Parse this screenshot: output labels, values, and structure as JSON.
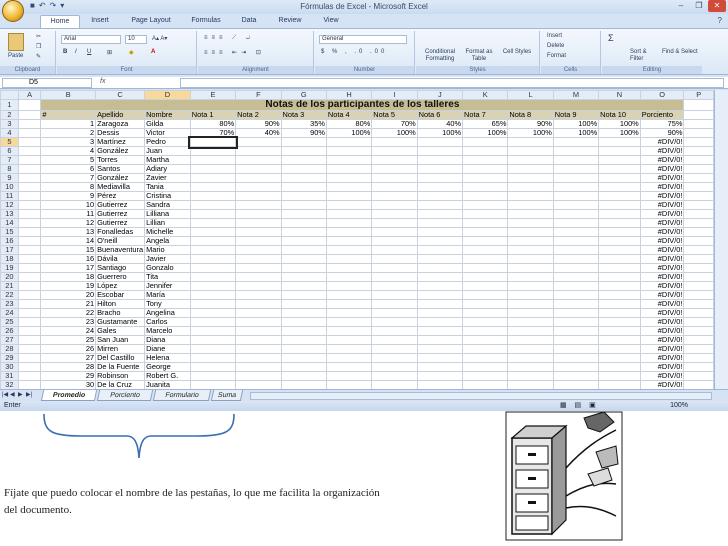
{
  "window": {
    "title": "Fórmulas de Excel - Microsoft Excel",
    "controls": [
      "–",
      "❐",
      "✕"
    ]
  },
  "ribbon": {
    "tabs": [
      "Home",
      "Insert",
      "Page Layout",
      "Formulas",
      "Data",
      "Review",
      "View"
    ],
    "active_tab": "Home",
    "paste": "Paste",
    "font_name": "Arial",
    "font_size": "10",
    "number_format": "General",
    "groups": [
      "Clipboard",
      "Font",
      "Alignment",
      "Number",
      "Styles",
      "Cells",
      "Editing"
    ],
    "styles": [
      "Conditional Formatting",
      "Format as Table",
      "Cell Styles"
    ],
    "cells": [
      "Insert",
      "Delete",
      "Format"
    ],
    "editing": [
      "Sort & Filter",
      "Find & Select"
    ]
  },
  "formula_bar": {
    "name_box": "D5",
    "fx": "fx",
    "value": ""
  },
  "sheet": {
    "columns": [
      "A",
      "B",
      "C",
      "D",
      "E",
      "F",
      "G",
      "H",
      "I",
      "J",
      "K",
      "L",
      "M",
      "N",
      "O",
      "P"
    ],
    "selected_col": "D",
    "selected_row": "5",
    "title": "Notas de los participantes de los talleres",
    "headers": [
      "#",
      "Apellido",
      "Nombre",
      "Nota 1",
      "Nota 2",
      "Nota 3",
      "Nota 4",
      "Nota 5",
      "Nota 6",
      "Nota 7",
      "Nota 8",
      "Nota 9",
      "Nota 10",
      "Porciento"
    ],
    "rows": [
      [
        "1",
        "Zaragoza",
        "Gilda",
        "80%",
        "90%",
        "35%",
        "80%",
        "70%",
        "40%",
        "65%",
        "90%",
        "100%",
        "100%",
        "75%"
      ],
      [
        "2",
        "Dessis",
        "Victor",
        "70%",
        "40%",
        "90%",
        "100%",
        "100%",
        "100%",
        "100%",
        "100%",
        "100%",
        "100%",
        "90%"
      ],
      [
        "3",
        "Martínez",
        "Pedro",
        "",
        "",
        "",
        "",
        "",
        "",
        "",
        "",
        "",
        "",
        "#DIV/0!"
      ],
      [
        "4",
        "González",
        "Juan",
        "",
        "",
        "",
        "",
        "",
        "",
        "",
        "",
        "",
        "",
        "#DIV/0!"
      ],
      [
        "5",
        "Torres",
        "Martha",
        "",
        "",
        "",
        "",
        "",
        "",
        "",
        "",
        "",
        "",
        "#DIV/0!"
      ],
      [
        "6",
        "Santos",
        "Adiary",
        "",
        "",
        "",
        "",
        "",
        "",
        "",
        "",
        "",
        "",
        "#DIV/0!"
      ],
      [
        "7",
        "González",
        "Zavier",
        "",
        "",
        "",
        "",
        "",
        "",
        "",
        "",
        "",
        "",
        "#DIV/0!"
      ],
      [
        "8",
        "Mediavilla",
        "Tania",
        "",
        "",
        "",
        "",
        "",
        "",
        "",
        "",
        "",
        "",
        "#DIV/0!"
      ],
      [
        "9",
        "Pérez",
        "Cristina",
        "",
        "",
        "",
        "",
        "",
        "",
        "",
        "",
        "",
        "",
        "#DIV/0!"
      ],
      [
        "10",
        "Gutierrez",
        "Sandra",
        "",
        "",
        "",
        "",
        "",
        "",
        "",
        "",
        "",
        "",
        "#DIV/0!"
      ],
      [
        "11",
        "Gutierrez",
        "Lilliana",
        "",
        "",
        "",
        "",
        "",
        "",
        "",
        "",
        "",
        "",
        "#DIV/0!"
      ],
      [
        "12",
        "Gutierrez",
        "Lillian",
        "",
        "",
        "",
        "",
        "",
        "",
        "",
        "",
        "",
        "",
        "#DIV/0!"
      ],
      [
        "13",
        "Fonalledas",
        "Michelle",
        "",
        "",
        "",
        "",
        "",
        "",
        "",
        "",
        "",
        "",
        "#DIV/0!"
      ],
      [
        "14",
        "O'neill",
        "Angela",
        "",
        "",
        "",
        "",
        "",
        "",
        "",
        "",
        "",
        "",
        "#DIV/0!"
      ],
      [
        "15",
        "Buenaventura",
        "Mario",
        "",
        "",
        "",
        "",
        "",
        "",
        "",
        "",
        "",
        "",
        "#DIV/0!"
      ],
      [
        "16",
        "Dávila",
        "Javier",
        "",
        "",
        "",
        "",
        "",
        "",
        "",
        "",
        "",
        "",
        "#DIV/0!"
      ],
      [
        "17",
        "Santiago",
        "Gonzalo",
        "",
        "",
        "",
        "",
        "",
        "",
        "",
        "",
        "",
        "",
        "#DIV/0!"
      ],
      [
        "18",
        "Guerrero",
        "Tita",
        "",
        "",
        "",
        "",
        "",
        "",
        "",
        "",
        "",
        "",
        "#DIV/0!"
      ],
      [
        "19",
        "López",
        "Jennifer",
        "",
        "",
        "",
        "",
        "",
        "",
        "",
        "",
        "",
        "",
        "#DIV/0!"
      ],
      [
        "20",
        "Escobar",
        "María",
        "",
        "",
        "",
        "",
        "",
        "",
        "",
        "",
        "",
        "",
        "#DIV/0!"
      ],
      [
        "21",
        "Hilton",
        "Tony",
        "",
        "",
        "",
        "",
        "",
        "",
        "",
        "",
        "",
        "",
        "#DIV/0!"
      ],
      [
        "22",
        "Bracho",
        "Angelina",
        "",
        "",
        "",
        "",
        "",
        "",
        "",
        "",
        "",
        "",
        "#DIV/0!"
      ],
      [
        "23",
        "Gustamante",
        "Carlos",
        "",
        "",
        "",
        "",
        "",
        "",
        "",
        "",
        "",
        "",
        "#DIV/0!"
      ],
      [
        "24",
        "Gales",
        "Marcelo",
        "",
        "",
        "",
        "",
        "",
        "",
        "",
        "",
        "",
        "",
        "#DIV/0!"
      ],
      [
        "25",
        "San Juan",
        "Diana",
        "",
        "",
        "",
        "",
        "",
        "",
        "",
        "",
        "",
        "",
        "#DIV/0!"
      ],
      [
        "26",
        "Mirren",
        "Diane",
        "",
        "",
        "",
        "",
        "",
        "",
        "",
        "",
        "",
        "",
        "#DIV/0!"
      ],
      [
        "27",
        "Del Castillo",
        "Helena",
        "",
        "",
        "",
        "",
        "",
        "",
        "",
        "",
        "",
        "",
        "#DIV/0!"
      ],
      [
        "28",
        "De la Fuente",
        "George",
        "",
        "",
        "",
        "",
        "",
        "",
        "",
        "",
        "",
        "",
        "#DIV/0!"
      ],
      [
        "29",
        "Robinson",
        "Robert G.",
        "",
        "",
        "",
        "",
        "",
        "",
        "",
        "",
        "",
        "",
        "#DIV/0!"
      ],
      [
        "30",
        "De la Cruz",
        "Juanita",
        "",
        "",
        "",
        "",
        "",
        "",
        "",
        "",
        "",
        "",
        "#DIV/0!"
      ]
    ],
    "row_numbers": [
      "1",
      "2",
      "3",
      "4",
      "5",
      "6",
      "7",
      "8",
      "9",
      "10",
      "11",
      "12",
      "13",
      "14",
      "15",
      "16",
      "17",
      "18",
      "19",
      "20",
      "21",
      "22",
      "23",
      "24",
      "25",
      "26",
      "27",
      "28",
      "29",
      "30",
      "31",
      "32",
      "33"
    ]
  },
  "sheet_tabs": [
    "Promedio",
    "Porciento",
    "Formulario",
    "Suma"
  ],
  "active_sheet": "Promedio",
  "status": "Enter",
  "zoom": "100%",
  "caption": "Fíjate que puedo colocar el nombre de las pestañas, lo que me facilita  la organización del documento."
}
